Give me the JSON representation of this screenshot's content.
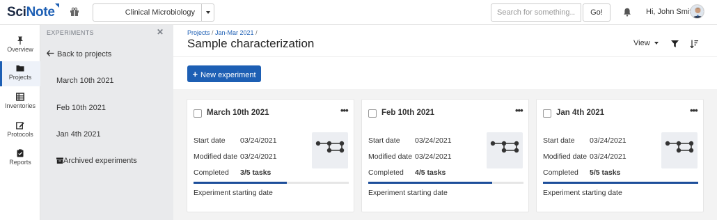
{
  "app": {
    "logo_sci": "Sci",
    "logo_note": "Note",
    "team": "Clinical Microbiology",
    "search_placeholder": "Search for something...",
    "search_button": "Go!",
    "greeting": "Hi, John Smith"
  },
  "nav": {
    "items": [
      {
        "label": "Overview",
        "icon": "pin-icon"
      },
      {
        "label": "Projects",
        "icon": "folder-icon"
      },
      {
        "label": "Inventories",
        "icon": "inventory-icon"
      },
      {
        "label": "Protocols",
        "icon": "edit-icon"
      },
      {
        "label": "Reports",
        "icon": "clipboard-icon"
      }
    ],
    "active": "Projects"
  },
  "experiments_sidebar": {
    "header": "EXPERIMENTS",
    "back_label": "Back to projects",
    "items": [
      "March 10th 2021",
      "Feb 10th 2021",
      "Jan 4th 2021"
    ],
    "archived_label": "Archived experiments"
  },
  "main": {
    "breadcrumb": [
      "Projects",
      "Jan-Mar 2021"
    ],
    "title": "Sample characterization",
    "view_label": "View",
    "new_experiment_label": "New experiment",
    "labels": {
      "start_date": "Start date",
      "modified_date": "Modified date",
      "completed": "Completed"
    },
    "cards": [
      {
        "title": "March 10th 2021",
        "start_date": "03/24/2021",
        "modified_date": "03/24/2021",
        "completed": "3/5 tasks",
        "progress": 0.6,
        "status": "Experiment starting date"
      },
      {
        "title": "Feb 10th 2021",
        "start_date": "03/24/2021",
        "modified_date": "03/24/2021",
        "completed": "4/5 tasks",
        "progress": 0.8,
        "status": "Experiment starting date"
      },
      {
        "title": "Jan 4th 2021",
        "start_date": "03/24/2021",
        "modified_date": "03/24/2021",
        "completed": "5/5 tasks",
        "progress": 1.0,
        "status": "Experiment starting date"
      }
    ]
  },
  "colors": {
    "brand_blue": "#1d5fb4",
    "progress_blue": "#1d4e9a",
    "sidebar_bg": "#e9eaec"
  }
}
